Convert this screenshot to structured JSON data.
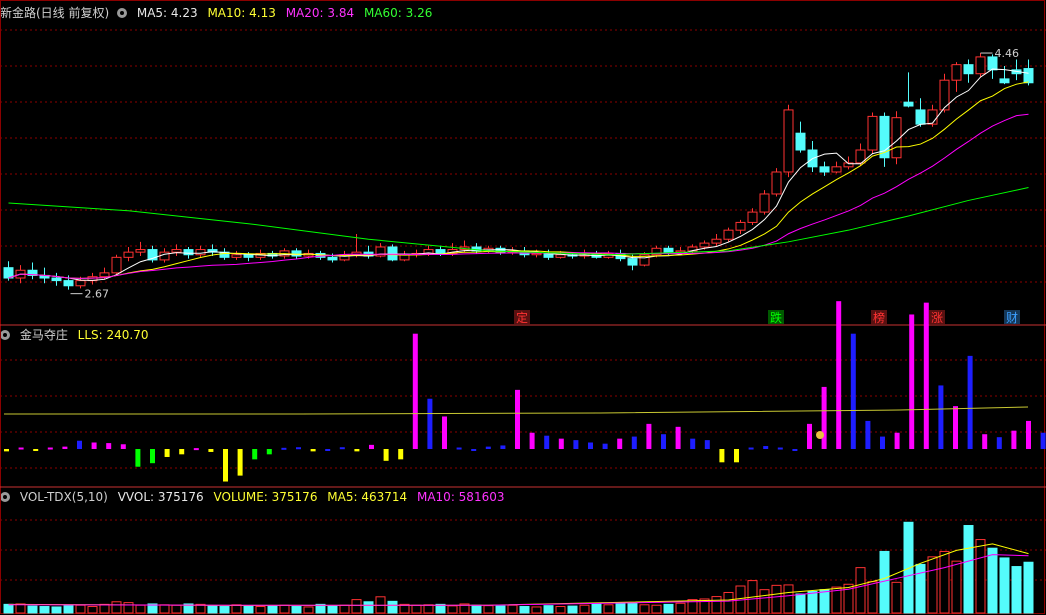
{
  "price_header": {
    "title": "新金路(日线 前复权)",
    "ma5_label": "MA5: 4.23",
    "ma10_label": "MA10: 4.13",
    "ma20_label": "MA20: 3.84",
    "ma60_label": "MA60: 3.26"
  },
  "indicator_header": {
    "title": "金马夺庄",
    "value_label": "LLS: 240.70"
  },
  "volume_header": {
    "title": "VOL-TDX(5,10)",
    "vvol_label": "VVOL: 375176",
    "volume_label": "VOLUME: 375176",
    "ma5_label": "MA5: 463714",
    "ma10_label": "MA10: 581603"
  },
  "markers": [
    "定",
    "跌",
    "榜",
    "涨",
    "财"
  ],
  "colors": {
    "up": "#ff3232",
    "down": "#54fcfc",
    "ma5": "#ffffff",
    "ma10": "#ffff00",
    "ma20": "#ff00ff",
    "ma60": "#00ff00",
    "grid": "#8b0000",
    "positive": "#ff00ff",
    "negative": "#ffff00"
  },
  "chart_data": {
    "type": "candlestick",
    "price_annotations": {
      "high": "4.46",
      "low": "2.67"
    },
    "price_range": [
      2.55,
      4.7
    ],
    "candles": [
      [
        2.8,
        2.72,
        2.85,
        2.7
      ],
      [
        2.72,
        2.78,
        2.82,
        2.68
      ],
      [
        2.78,
        2.74,
        2.84,
        2.71
      ],
      [
        2.74,
        2.72,
        2.8,
        2.68
      ],
      [
        2.72,
        2.7,
        2.76,
        2.66
      ],
      [
        2.7,
        2.66,
        2.74,
        2.63
      ],
      [
        2.66,
        2.7,
        2.73,
        2.64
      ],
      [
        2.7,
        2.73,
        2.76,
        2.67
      ],
      [
        2.73,
        2.76,
        2.8,
        2.71
      ],
      [
        2.76,
        2.88,
        2.9,
        2.75
      ],
      [
        2.88,
        2.92,
        2.96,
        2.85
      ],
      [
        2.92,
        2.94,
        3.0,
        2.89
      ],
      [
        2.94,
        2.86,
        2.97,
        2.84
      ],
      [
        2.86,
        2.92,
        2.95,
        2.84
      ],
      [
        2.92,
        2.94,
        2.98,
        2.89
      ],
      [
        2.94,
        2.9,
        2.96,
        2.87
      ],
      [
        2.9,
        2.94,
        2.97,
        2.88
      ],
      [
        2.94,
        2.92,
        2.98,
        2.89
      ],
      [
        2.92,
        2.88,
        2.95,
        2.86
      ],
      [
        2.88,
        2.9,
        2.93,
        2.86
      ],
      [
        2.9,
        2.88,
        2.92,
        2.85
      ],
      [
        2.88,
        2.91,
        2.94,
        2.86
      ],
      [
        2.91,
        2.89,
        2.93,
        2.87
      ],
      [
        2.89,
        2.93,
        2.95,
        2.87
      ],
      [
        2.93,
        2.89,
        2.95,
        2.87
      ],
      [
        2.89,
        2.91,
        2.94,
        2.87
      ],
      [
        2.91,
        2.88,
        2.93,
        2.86
      ],
      [
        2.88,
        2.86,
        2.91,
        2.84
      ],
      [
        2.86,
        2.9,
        2.93,
        2.85
      ],
      [
        2.9,
        2.92,
        3.06,
        2.88
      ],
      [
        2.92,
        2.89,
        2.97,
        2.87
      ],
      [
        2.89,
        2.96,
        2.99,
        2.88
      ],
      [
        2.96,
        2.86,
        2.98,
        2.85
      ],
      [
        2.86,
        2.9,
        2.93,
        2.85
      ],
      [
        2.9,
        2.91,
        2.94,
        2.88
      ],
      [
        2.91,
        2.94,
        2.97,
        2.89
      ],
      [
        2.94,
        2.91,
        2.97,
        2.89
      ],
      [
        2.91,
        2.94,
        2.99,
        2.89
      ],
      [
        2.94,
        2.96,
        3.01,
        2.92
      ],
      [
        2.96,
        2.93,
        2.99,
        2.91
      ],
      [
        2.93,
        2.95,
        2.97,
        2.91
      ],
      [
        2.95,
        2.92,
        2.97,
        2.9
      ],
      [
        2.92,
        2.93,
        2.96,
        2.9
      ],
      [
        2.93,
        2.9,
        2.96,
        2.88
      ],
      [
        2.9,
        2.91,
        2.94,
        2.88
      ],
      [
        2.91,
        2.88,
        2.94,
        2.86
      ],
      [
        2.88,
        2.9,
        2.93,
        2.87
      ],
      [
        2.9,
        2.89,
        2.92,
        2.87
      ],
      [
        2.89,
        2.91,
        2.94,
        2.87
      ],
      [
        2.91,
        2.88,
        2.93,
        2.87
      ],
      [
        2.88,
        2.91,
        2.93,
        2.87
      ],
      [
        2.91,
        2.87,
        2.94,
        2.85
      ],
      [
        2.87,
        2.82,
        2.9,
        2.78
      ],
      [
        2.82,
        2.9,
        2.92,
        2.81
      ],
      [
        2.9,
        2.95,
        2.97,
        2.88
      ],
      [
        2.95,
        2.92,
        2.97,
        2.9
      ],
      [
        2.92,
        2.93,
        2.96,
        2.9
      ],
      [
        2.93,
        2.96,
        2.98,
        2.91
      ],
      [
        2.96,
        2.99,
        3.01,
        2.94
      ],
      [
        2.99,
        3.02,
        3.06,
        2.97
      ],
      [
        3.02,
        3.09,
        3.11,
        3.0
      ],
      [
        3.09,
        3.15,
        3.17,
        3.06
      ],
      [
        3.15,
        3.23,
        3.26,
        3.13
      ],
      [
        3.23,
        3.37,
        3.4,
        3.21
      ],
      [
        3.37,
        3.54,
        3.57,
        3.35
      ],
      [
        3.54,
        4.02,
        4.06,
        3.5
      ],
      [
        3.84,
        3.71,
        3.93,
        3.69
      ],
      [
        3.71,
        3.58,
        3.78,
        3.54
      ],
      [
        3.58,
        3.54,
        3.62,
        3.51
      ],
      [
        3.54,
        3.58,
        3.62,
        3.53
      ],
      [
        3.58,
        3.61,
        3.66,
        3.56
      ],
      [
        3.61,
        3.71,
        3.76,
        3.59
      ],
      [
        3.71,
        3.97,
        4.0,
        3.68
      ],
      [
        3.97,
        3.65,
        4.0,
        3.58
      ],
      [
        3.65,
        3.96,
        4.01,
        3.6
      ],
      [
        4.08,
        4.05,
        4.31,
        4.04
      ],
      [
        4.02,
        3.91,
        4.11,
        3.89
      ],
      [
        3.91,
        4.02,
        4.06,
        3.89
      ],
      [
        4.02,
        4.25,
        4.3,
        4.0
      ],
      [
        4.25,
        4.37,
        4.39,
        4.16
      ],
      [
        4.37,
        4.3,
        4.41,
        4.23
      ],
      [
        4.3,
        4.43,
        4.46,
        4.27
      ],
      [
        4.43,
        4.33,
        4.45,
        4.26
      ],
      [
        4.26,
        4.23,
        4.36,
        4.22
      ],
      [
        4.33,
        4.3,
        4.41,
        4.25
      ],
      [
        4.34,
        4.23,
        4.41,
        4.21
      ]
    ],
    "ma60": [
      [
        0,
        3.3
      ],
      [
        10,
        3.24
      ],
      [
        20,
        3.14
      ],
      [
        30,
        3.02
      ],
      [
        40,
        2.93
      ],
      [
        50,
        2.9
      ],
      [
        60,
        2.93
      ],
      [
        65,
        3.0
      ],
      [
        70,
        3.09
      ],
      [
        75,
        3.2
      ],
      [
        80,
        3.32
      ],
      [
        85,
        3.42
      ]
    ],
    "indicator": {
      "lls_level": 240.7,
      "range": [
        -180,
        510
      ],
      "bars": [
        -8,
        5,
        -6,
        5,
        8,
        28,
        22,
        20,
        16,
        -60,
        -48,
        -27,
        -18,
        3,
        -10,
        -110,
        -90,
        -35,
        -18,
        4,
        6,
        -8,
        0,
        6,
        -8,
        14,
        -40,
        -35,
        390,
        170,
        110,
        5,
        0,
        8,
        12,
        200,
        55,
        45,
        35,
        30,
        22,
        18,
        35,
        42,
        85,
        50,
        75,
        35,
        30,
        -45,
        -45,
        5,
        10,
        5,
        0,
        85,
        210,
        500,
        390,
        95,
        42,
        55,
        455,
        495,
        215,
        145,
        315,
        50,
        40,
        62,
        95,
        55,
        35,
        0,
        8,
        0
      ],
      "colors": [
        "n",
        "p",
        "n",
        "p",
        "p",
        "b",
        "p",
        "p",
        "p",
        "n",
        "n",
        "n",
        "n",
        "p",
        "n",
        "n",
        "n",
        "n",
        "n",
        "b",
        "b",
        "n",
        "b",
        "b",
        "n",
        "p",
        "n",
        "n",
        "p",
        "b",
        "p",
        "b",
        "b",
        "b",
        "b",
        "p",
        "p",
        "b",
        "p",
        "b",
        "b",
        "b",
        "p",
        "b",
        "p",
        "b",
        "p",
        "b",
        "b",
        "n",
        "n",
        "b",
        "b",
        "b",
        "b",
        "p",
        "p",
        "p",
        "b",
        "b",
        "b",
        "p",
        "p",
        "p",
        "b",
        "p",
        "b",
        "p",
        "b",
        "p",
        "p",
        "b",
        "p",
        "b",
        "p",
        "b"
      ]
    },
    "volume": {
      "range": [
        0,
        500000
      ],
      "bars": [
        40,
        42,
        32,
        30,
        28,
        34,
        36,
        30,
        40,
        52,
        48,
        36,
        42,
        38,
        36,
        42,
        40,
        33,
        30,
        38,
        35,
        30,
        32,
        36,
        30,
        28,
        40,
        32,
        36,
        62,
        52,
        75,
        54,
        40,
        36,
        38,
        40,
        33,
        42,
        36,
        34,
        32,
        36,
        30,
        28,
        34,
        30,
        32,
        36,
        42,
        38,
        48,
        45,
        38,
        36,
        40,
        45,
        62,
        65,
        76,
        95,
        125,
        150,
        108,
        128,
        130,
        88,
        100,
        108,
        120,
        133,
        210,
        145,
        285,
        142,
        420,
        225,
        260,
        285,
        240,
        405,
        340,
        300,
        255,
        215,
        235
      ],
      "ma5": [
        [
          0,
          40
        ],
        [
          20,
          35
        ],
        [
          40,
          36
        ],
        [
          60,
          60
        ],
        [
          65,
          95
        ],
        [
          70,
          118
        ],
        [
          73,
          160
        ],
        [
          76,
          230
        ],
        [
          79,
          290
        ],
        [
          82,
          320
        ],
        [
          85,
          275
        ]
      ],
      "ma10": [
        [
          0,
          38
        ],
        [
          20,
          36
        ],
        [
          40,
          36
        ],
        [
          60,
          55
        ],
        [
          65,
          80
        ],
        [
          70,
          110
        ],
        [
          74,
          160
        ],
        [
          78,
          210
        ],
        [
          82,
          270
        ],
        [
          85,
          265
        ]
      ]
    }
  }
}
